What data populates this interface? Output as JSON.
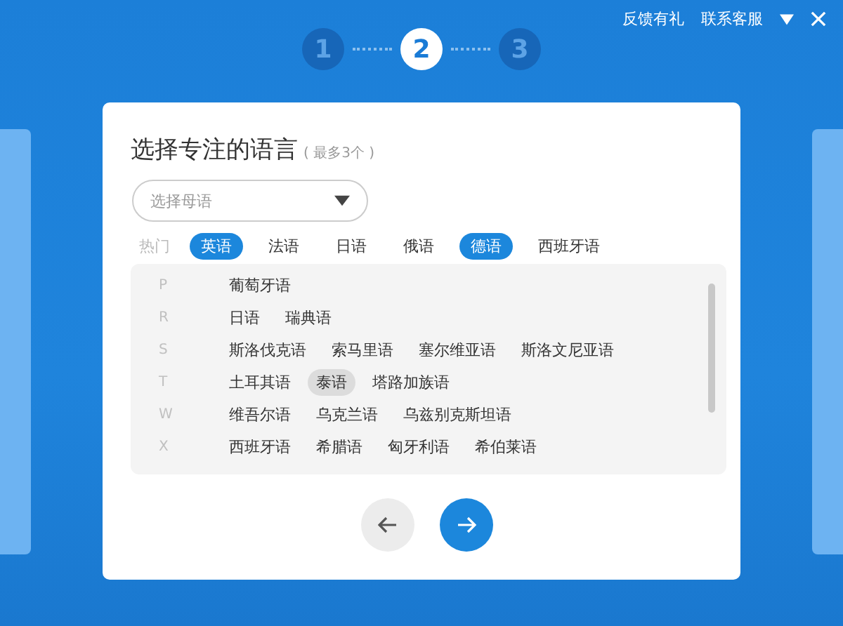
{
  "steps": [
    {
      "label": "1",
      "selected": false
    },
    {
      "label": "2",
      "selected": true
    },
    {
      "label": "3",
      "selected": false
    }
  ],
  "top_links": [
    "反馈有礼",
    "联系客服"
  ],
  "title": "选择专注的语言",
  "title_hint": "( 最多3个 )",
  "native_select": {
    "placeholder": "选择母语"
  },
  "hot": {
    "label": "热门",
    "items": [
      {
        "label": "英语",
        "selected": true
      },
      {
        "label": "法语",
        "selected": false
      },
      {
        "label": "日语",
        "selected": false
      },
      {
        "label": "俄语",
        "selected": false
      },
      {
        "label": "德语",
        "selected": true
      },
      {
        "label": "西班牙语",
        "selected": false
      }
    ]
  },
  "groups": [
    {
      "letter": "P",
      "items": [
        {
          "label": "葡萄牙语",
          "hovered": false
        }
      ]
    },
    {
      "letter": "R",
      "items": [
        {
          "label": "日语",
          "hovered": false
        },
        {
          "label": "瑞典语",
          "hovered": false
        }
      ]
    },
    {
      "letter": "S",
      "items": [
        {
          "label": "斯洛伐克语",
          "hovered": false
        },
        {
          "label": "索马里语",
          "hovered": false
        },
        {
          "label": "塞尔维亚语",
          "hovered": false
        },
        {
          "label": "斯洛文尼亚语",
          "hovered": false
        }
      ]
    },
    {
      "letter": "T",
      "items": [
        {
          "label": "土耳其语",
          "hovered": false
        },
        {
          "label": "泰语",
          "hovered": true
        },
        {
          "label": "塔路加族语",
          "hovered": false
        }
      ]
    },
    {
      "letter": "W",
      "items": [
        {
          "label": "维吾尔语",
          "hovered": false
        },
        {
          "label": "乌克兰语",
          "hovered": false
        },
        {
          "label": "乌兹别克斯坦语",
          "hovered": false
        }
      ]
    },
    {
      "letter": "X",
      "items": [
        {
          "label": "西班牙语",
          "hovered": false
        },
        {
          "label": "希腊语",
          "hovered": false
        },
        {
          "label": "匈牙利语",
          "hovered": false
        },
        {
          "label": "希伯莱语",
          "hovered": false
        }
      ]
    }
  ]
}
